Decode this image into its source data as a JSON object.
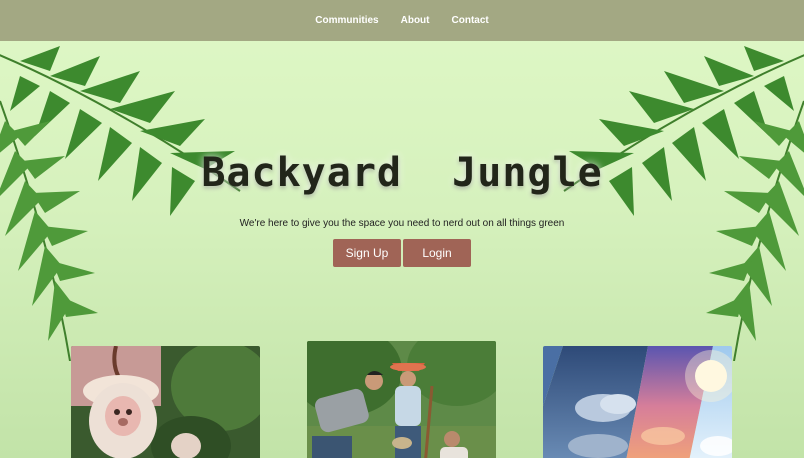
{
  "nav": {
    "links": [
      "Communities",
      "About",
      "Contact"
    ],
    "background": "#a3a883"
  },
  "hero": {
    "title": "Backyard  Jungle",
    "tagline": "We're here to give you the space you need to nerd out on all things green",
    "signup_label": "Sign Up",
    "login_label": "Login",
    "button_color": "#a06456"
  },
  "cards": [
    {
      "image": "monkey-orchid-photo"
    },
    {
      "image": "gardening-people-photo"
    },
    {
      "image": "sky-weather-photo"
    }
  ]
}
